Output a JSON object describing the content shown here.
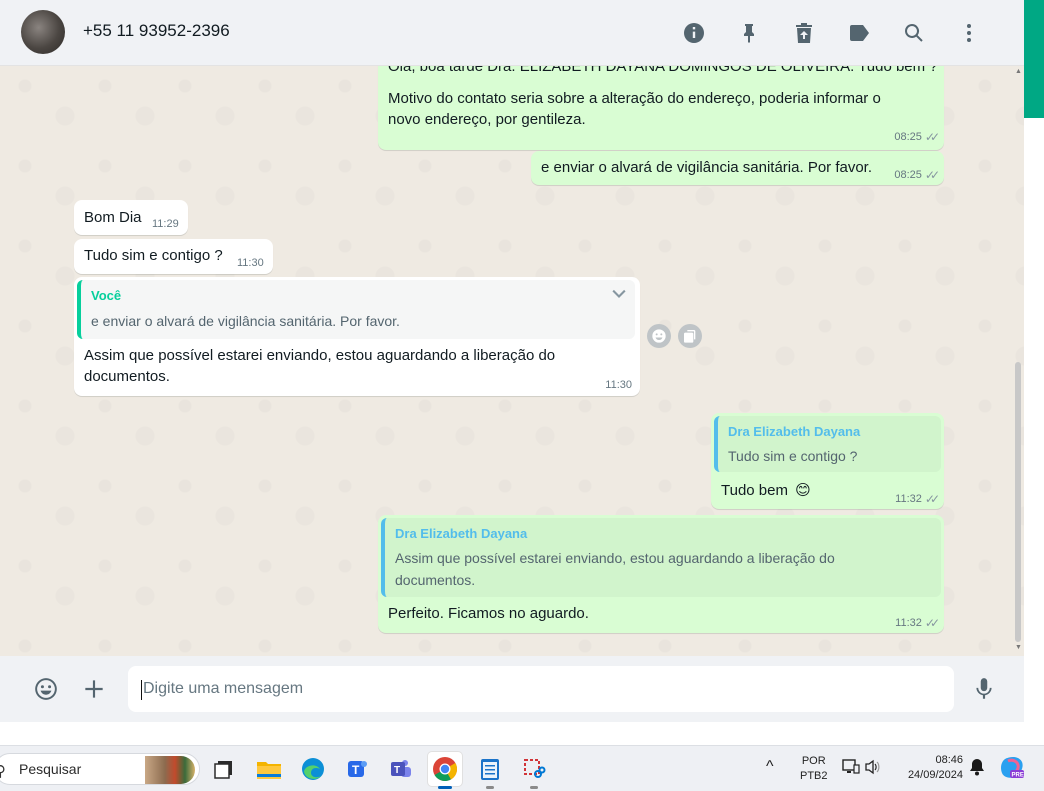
{
  "header": {
    "contact_name": "+55 11 93952-2396",
    "icons": [
      "info-icon",
      "pin-icon",
      "delete-icon",
      "label-icon",
      "search-icon",
      "menu-icon"
    ]
  },
  "messages": {
    "m1": {
      "line1": "Olá, boa tarde Dra. ELIZABETH DAYANA DOMINGOS DE OLIVEIRA. Tudo bem ?",
      "line2": "Motivo do contato seria sobre a alteração do endereço, poderia informar o",
      "line3": "novo endereço, por gentileza.",
      "time": "08:25"
    },
    "m2": {
      "text": "e enviar o alvará de vigilância sanitária. Por favor.",
      "time": "08:25"
    },
    "m3": {
      "text": "Bom Dia",
      "time": "11:29"
    },
    "m4": {
      "text": "Tudo sim e contigo ?",
      "time": "11:30"
    },
    "m5": {
      "quote_author": "Você",
      "quote_text": "e enviar o alvará de vigilância sanitária. Por favor.",
      "line1": "Assim que possível estarei enviando, estou aguardando a liberação do",
      "line2": "documentos.",
      "time": "11:30"
    },
    "m6": {
      "quote_author": "Dra Elizabeth Dayana",
      "quote_text": "Tudo sim e contigo ?",
      "text": "Tudo bem",
      "emoji": "😊",
      "time": "11:32"
    },
    "m7": {
      "quote_author": "Dra Elizabeth Dayana",
      "quote_line1": "Assim que possível estarei enviando, estou aguardando a liberação do",
      "quote_line2": "documentos.",
      "text": "Perfeito. Ficamos no aguardo.",
      "time": "11:32"
    },
    "read_ticks": "✓✓"
  },
  "composer": {
    "placeholder": "Digite uma mensagem",
    "icons": [
      "emoji-icon",
      "plus-icon",
      "microphone-icon"
    ]
  },
  "taskbar": {
    "search_label": "Pesquisar",
    "apps": [
      "task-view",
      "file-explorer",
      "edge",
      "teams-blue",
      "teams-purple",
      "chrome",
      "notepad",
      "snipping-tool"
    ],
    "lang_top": "POR",
    "lang_bottom": "PTB2",
    "time": "08:46",
    "date": "24/09/2024",
    "chevron": "^"
  },
  "colors": {
    "outgoing_bubble": "#d9fdd3",
    "incoming_bubble": "#ffffff",
    "chat_bg": "#efeae2",
    "accent_green": "#00a884",
    "quote_you": "#06cf9c",
    "quote_contact": "#53bdeb"
  }
}
